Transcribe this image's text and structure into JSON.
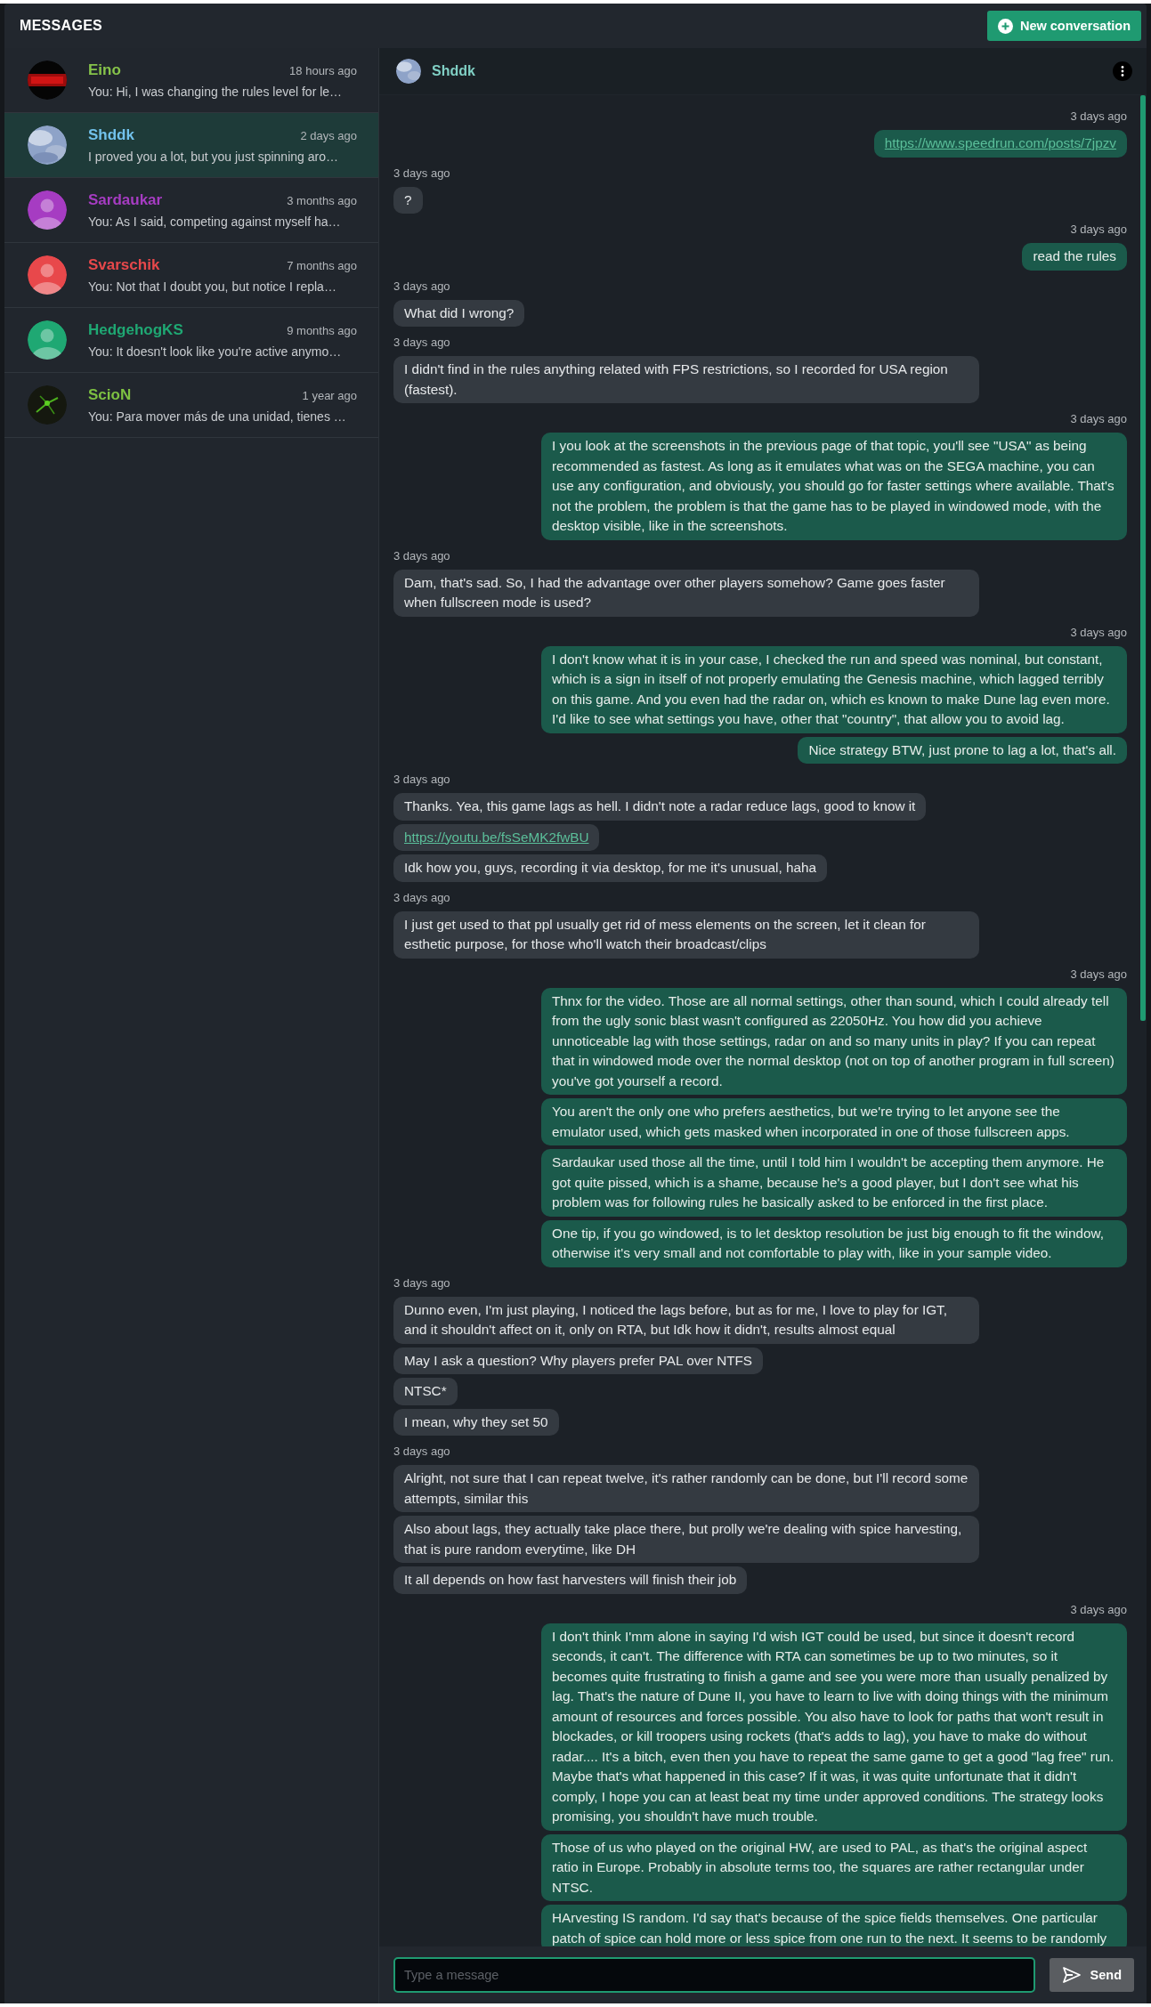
{
  "header": {
    "title": "MESSAGES",
    "new_button": "New conversation"
  },
  "conversations": [
    {
      "name": "Eino",
      "color": "#86c34a",
      "time": "18 hours ago",
      "preview": "You: Hi, I was changing the rules level for le…",
      "kind": "picture",
      "selected": false
    },
    {
      "name": "Shddk",
      "color": "#72c2ec",
      "time": "2 days ago",
      "preview": "I proved you a lot, but you just spinning aro…",
      "kind": "picture",
      "selected": true
    },
    {
      "name": "Sardaukar",
      "color": "#a63cc2",
      "time": "3 months ago",
      "preview": "You: As I said, competing against myself ha…",
      "kind": "person",
      "selected": false
    },
    {
      "name": "Svarschik",
      "color": "#e8484b",
      "time": "7 months ago",
      "preview": "You: Not that I doubt you, but notice I repla…",
      "kind": "person",
      "selected": false
    },
    {
      "name": "HedgehogKS",
      "color": "#1fa873",
      "time": "9 months ago",
      "preview": "You: It doesn't look like you're active anymo…",
      "kind": "person",
      "selected": false
    },
    {
      "name": "ScioN",
      "color": "#7dc142",
      "time": "1 year ago",
      "preview": "You: Para mover más de una unidad, tienes …",
      "kind": "picture",
      "selected": false
    }
  ],
  "chat": {
    "name": "Shddk",
    "groups": [
      {
        "kind": "me",
        "time": "3 days ago",
        "messages": [
          {
            "kind": "link",
            "text": "https://www.speedrun.com/posts/7jpzv"
          }
        ]
      },
      {
        "kind": "them",
        "time": "3 days ago",
        "messages": [
          {
            "kind": "text",
            "text": "?"
          }
        ]
      },
      {
        "kind": "me",
        "time": "3 days ago",
        "messages": [
          {
            "kind": "text",
            "text": "read the rules"
          }
        ]
      },
      {
        "kind": "them",
        "time": "3 days ago",
        "messages": [
          {
            "kind": "text",
            "text": "What did I wrong?"
          }
        ]
      },
      {
        "kind": "them",
        "time": "3 days ago",
        "messages": [
          {
            "kind": "text",
            "text": "I didn't find in the rules anything related with FPS restrictions, so I recorded for USA region (fastest)."
          }
        ]
      },
      {
        "kind": "me",
        "time": "3 days ago",
        "messages": [
          {
            "kind": "text",
            "text": "I you look at the screenshots in the previous page of that topic, you'll see \"USA\" as being recommended as fastest. As long as it emulates what was on the SEGA machine, you can use any configuration, and obviously, you should go for faster settings where available. That's not the problem, the problem is that the game has to be played in windowed mode, with the desktop visible, like in the screenshots."
          }
        ]
      },
      {
        "kind": "them",
        "time": "3 days ago",
        "messages": [
          {
            "kind": "text",
            "text": "Dam, that's sad. So, I had the advantage over other players somehow? Game goes faster when fullscreen mode is used?"
          }
        ]
      },
      {
        "kind": "me",
        "time": "3 days ago",
        "messages": [
          {
            "kind": "text",
            "text": "I don't know what it is in your case, I checked the run and speed was nominal, but constant, which is a sign in itself of not properly emulating the Genesis machine, which lagged terribly on this game. And you even had the radar on, which es known to make Dune lag even more. I'd like to see what settings you have, other that \"country\", that allow you to avoid lag."
          },
          {
            "kind": "text",
            "text": "Nice strategy BTW, just prone to lag a lot, that's all."
          }
        ]
      },
      {
        "kind": "them",
        "time": "3 days ago",
        "messages": [
          {
            "kind": "text",
            "text": "Thanks. Yea, this game lags as hell. I didn't note a radar reduce lags, good to know it"
          },
          {
            "kind": "link",
            "text": "https://youtu.be/fsSeMK2fwBU"
          },
          {
            "kind": "text",
            "text": "Idk how you, guys, recording it via desktop, for me it's unusual, haha"
          }
        ]
      },
      {
        "kind": "them",
        "time": "3 days ago",
        "messages": [
          {
            "kind": "text",
            "text": "I just get used to that ppl usually get rid of mess elements on the screen, let it clean for esthetic purpose, for those who'll watch their broadcast/clips"
          }
        ]
      },
      {
        "kind": "me",
        "time": "3 days ago",
        "messages": [
          {
            "kind": "text",
            "text": "Thnx for the video. Those are all normal settings, other than sound, which I could already tell from the ugly sonic blast wasn't configured as 22050Hz. You how did you achieve unnoticeable lag with those settings, radar on and so many units in play? If you can repeat that in windowed mode over the normal desktop (not on top of another program in full screen) you've got yourself a record."
          },
          {
            "kind": "text",
            "text": "You aren't the only one who prefers aesthetics, but we're trying to let anyone see the emulator used, which gets masked when incorporated in one of those fullscreen apps."
          },
          {
            "kind": "text",
            "text": "Sardaukar used those all the time, until I told him I wouldn't be accepting them anymore. He got quite pissed, which is a shame, because he's a good player, but I don't see what his problem was for following rules he basically asked to be enforced in the first place."
          },
          {
            "kind": "text",
            "text": "One tip, if you go windowed, is to let desktop resolution be just big enough to fit the window, otherwise it's very small and not comfortable to play with, like in your sample video."
          }
        ]
      },
      {
        "kind": "them",
        "time": "3 days ago",
        "messages": [
          {
            "kind": "text",
            "text": "Dunno even, I'm just playing, I noticed the lags before, but as for me, I love to play for IGT, and it shouldn't affect on it, only on RTA, but Idk how it didn't, results almost equal"
          },
          {
            "kind": "text",
            "text": "May I ask a question? Why players prefer PAL over NTFS"
          },
          {
            "kind": "text",
            "text": "NTSC*"
          },
          {
            "kind": "text",
            "text": "I mean, why they set 50"
          }
        ]
      },
      {
        "kind": "them",
        "time": "3 days ago",
        "messages": [
          {
            "kind": "text",
            "text": "Alright, not sure that I can repeat twelve, it's rather randomly can be done, but I'll record some attempts, similar this"
          },
          {
            "kind": "text",
            "text": "Also about lags, they actually take place there, but prolly we're dealing with spice harvesting, that is pure random everytime, like DH"
          },
          {
            "kind": "text",
            "text": "It all depends on how fast harvesters will finish their job"
          }
        ]
      },
      {
        "kind": "me",
        "time": "3 days ago",
        "messages": [
          {
            "kind": "text",
            "text": "I don't think I'mm alone in saying I'd wish IGT could be used, but since it doesn't record seconds, it can't. The difference with RTA can sometimes be up to two minutes, so it becomes quite frustrating to finish a game and see you were more than usually penalized by lag. That's the nature of Dune II, you have to learn to live with doing things with the minimum amount of resources and forces possible. You also have to look for paths that won't result in blockades, or kill troopers using rockets (that's adds to lag), you have to make do without radar.... It's a bitch, even then you have to repeat the same game to get a good \"lag free\" run. Maybe that's what happened in this case? If it was, it was quite unfortunate that it didn't comply, I hope you can at least beat my time under approved conditions. The strategy looks promising, you shouldn't have much trouble."
          },
          {
            "kind": "text",
            "text": "Those of us who played on the original HW, are used to PAL, as that's the original aspect ratio in Europe. Probably in absolute terms too, the squares are rather rectangular under NTSC."
          },
          {
            "kind": "text",
            "text": "HArvesting IS random. I'd say that's because of the spice fields themselves. One particular patch of spice can hold more or less spice from one run to the next. It seems to be randomly"
          }
        ]
      }
    ]
  },
  "composer": {
    "placeholder": "Type a message",
    "send": "Send"
  }
}
